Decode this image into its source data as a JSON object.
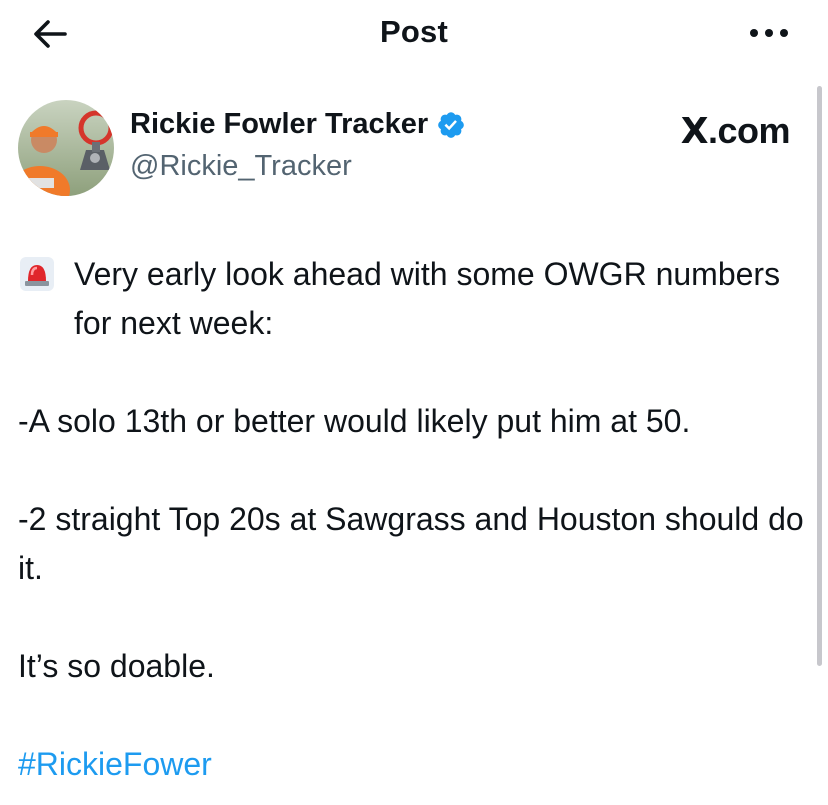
{
  "header": {
    "title": "Post",
    "back_icon": "arrow-left-icon",
    "more_icon": "more-horizontal-icon"
  },
  "author": {
    "display_name": "Rickie Fowler Tracker",
    "handle": "@Rickie_Tracker",
    "verified": true,
    "verified_color": "#1d9bf0"
  },
  "brand": {
    "label": ".com",
    "logo": "X"
  },
  "tweet": {
    "line1_emoji": "siren-icon",
    "line1": "Very early look ahead with some OWGR numbers for next week:",
    "p2": "-A solo 13th or better would likely put him at 50.",
    "p3": "-2 straight Top 20s at Sawgrass and Houston should do it.",
    "p4": "It’s so doable.",
    "hashtag": "#RickieFower"
  },
  "colors": {
    "text": "#0f1419",
    "secondary": "#536471",
    "link": "#1d9bf0"
  }
}
